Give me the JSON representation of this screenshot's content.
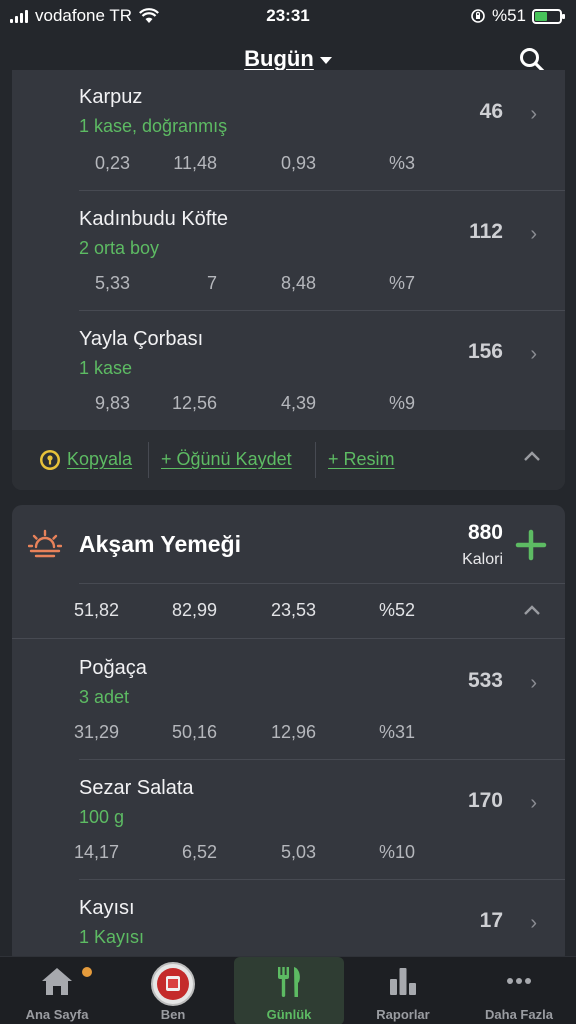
{
  "status": {
    "carrier": "vodafone TR",
    "time": "23:31",
    "battery": "%51",
    "battery_level": 0.51
  },
  "header": {
    "title": "Bugün",
    "icons": [
      "chevron-down-icon",
      "search-icon"
    ]
  },
  "meal1": {
    "items": [
      {
        "name": "Karpuz",
        "portion": "1 kase, doğranmış",
        "calories": "46",
        "m1": "0,23",
        "m2": "11,48",
        "m3": "0,93",
        "m4": "%3"
      },
      {
        "name": "Kadınbudu Köfte",
        "portion": "2 orta boy",
        "calories": "112",
        "m1": "5,33",
        "m2": "7",
        "m3": "8,48",
        "m4": "%7"
      },
      {
        "name": "Yayla Çorbası",
        "portion": "1 kase",
        "calories": "156",
        "m1": "9,83",
        "m2": "12,56",
        "m3": "4,39",
        "m4": "%9"
      }
    ],
    "actions": {
      "copy": "Kopyala",
      "save_meal": "+ Öğünü Kaydet",
      "photo": "+ Resim"
    }
  },
  "meal2": {
    "title": "Akşam Yemeği",
    "calories": "880",
    "calories_unit": "Kalori",
    "totals": {
      "m1": "51,82",
      "m2": "82,99",
      "m3": "23,53",
      "m4": "%52"
    },
    "items": [
      {
        "name": "Poğaça",
        "portion": "3 adet",
        "calories": "533",
        "m1": "31,29",
        "m2": "50,16",
        "m3": "12,96",
        "m4": "%31"
      },
      {
        "name": "Sezar Salata",
        "portion": "100 g",
        "calories": "170",
        "m1": "14,17",
        "m2": "6,52",
        "m3": "5,03",
        "m4": "%10"
      },
      {
        "name": "Kayısı",
        "portion": "1 Kayısı",
        "calories": "17"
      }
    ]
  },
  "tabs": [
    {
      "label": "Ana Sayfa",
      "icon": "home-icon"
    },
    {
      "label": "Ben",
      "icon": "avatar-icon"
    },
    {
      "label": "Günlük",
      "icon": "fork-knife-icon"
    },
    {
      "label": "Raporlar",
      "icon": "bar-chart-icon"
    },
    {
      "label": "Daha Fazla",
      "icon": "more-icon"
    }
  ],
  "colors": {
    "accent": "#5dbb63",
    "background": "#24272c",
    "card": "#34373e",
    "sunset": "#e8825a",
    "badge": "#e59b3c"
  }
}
